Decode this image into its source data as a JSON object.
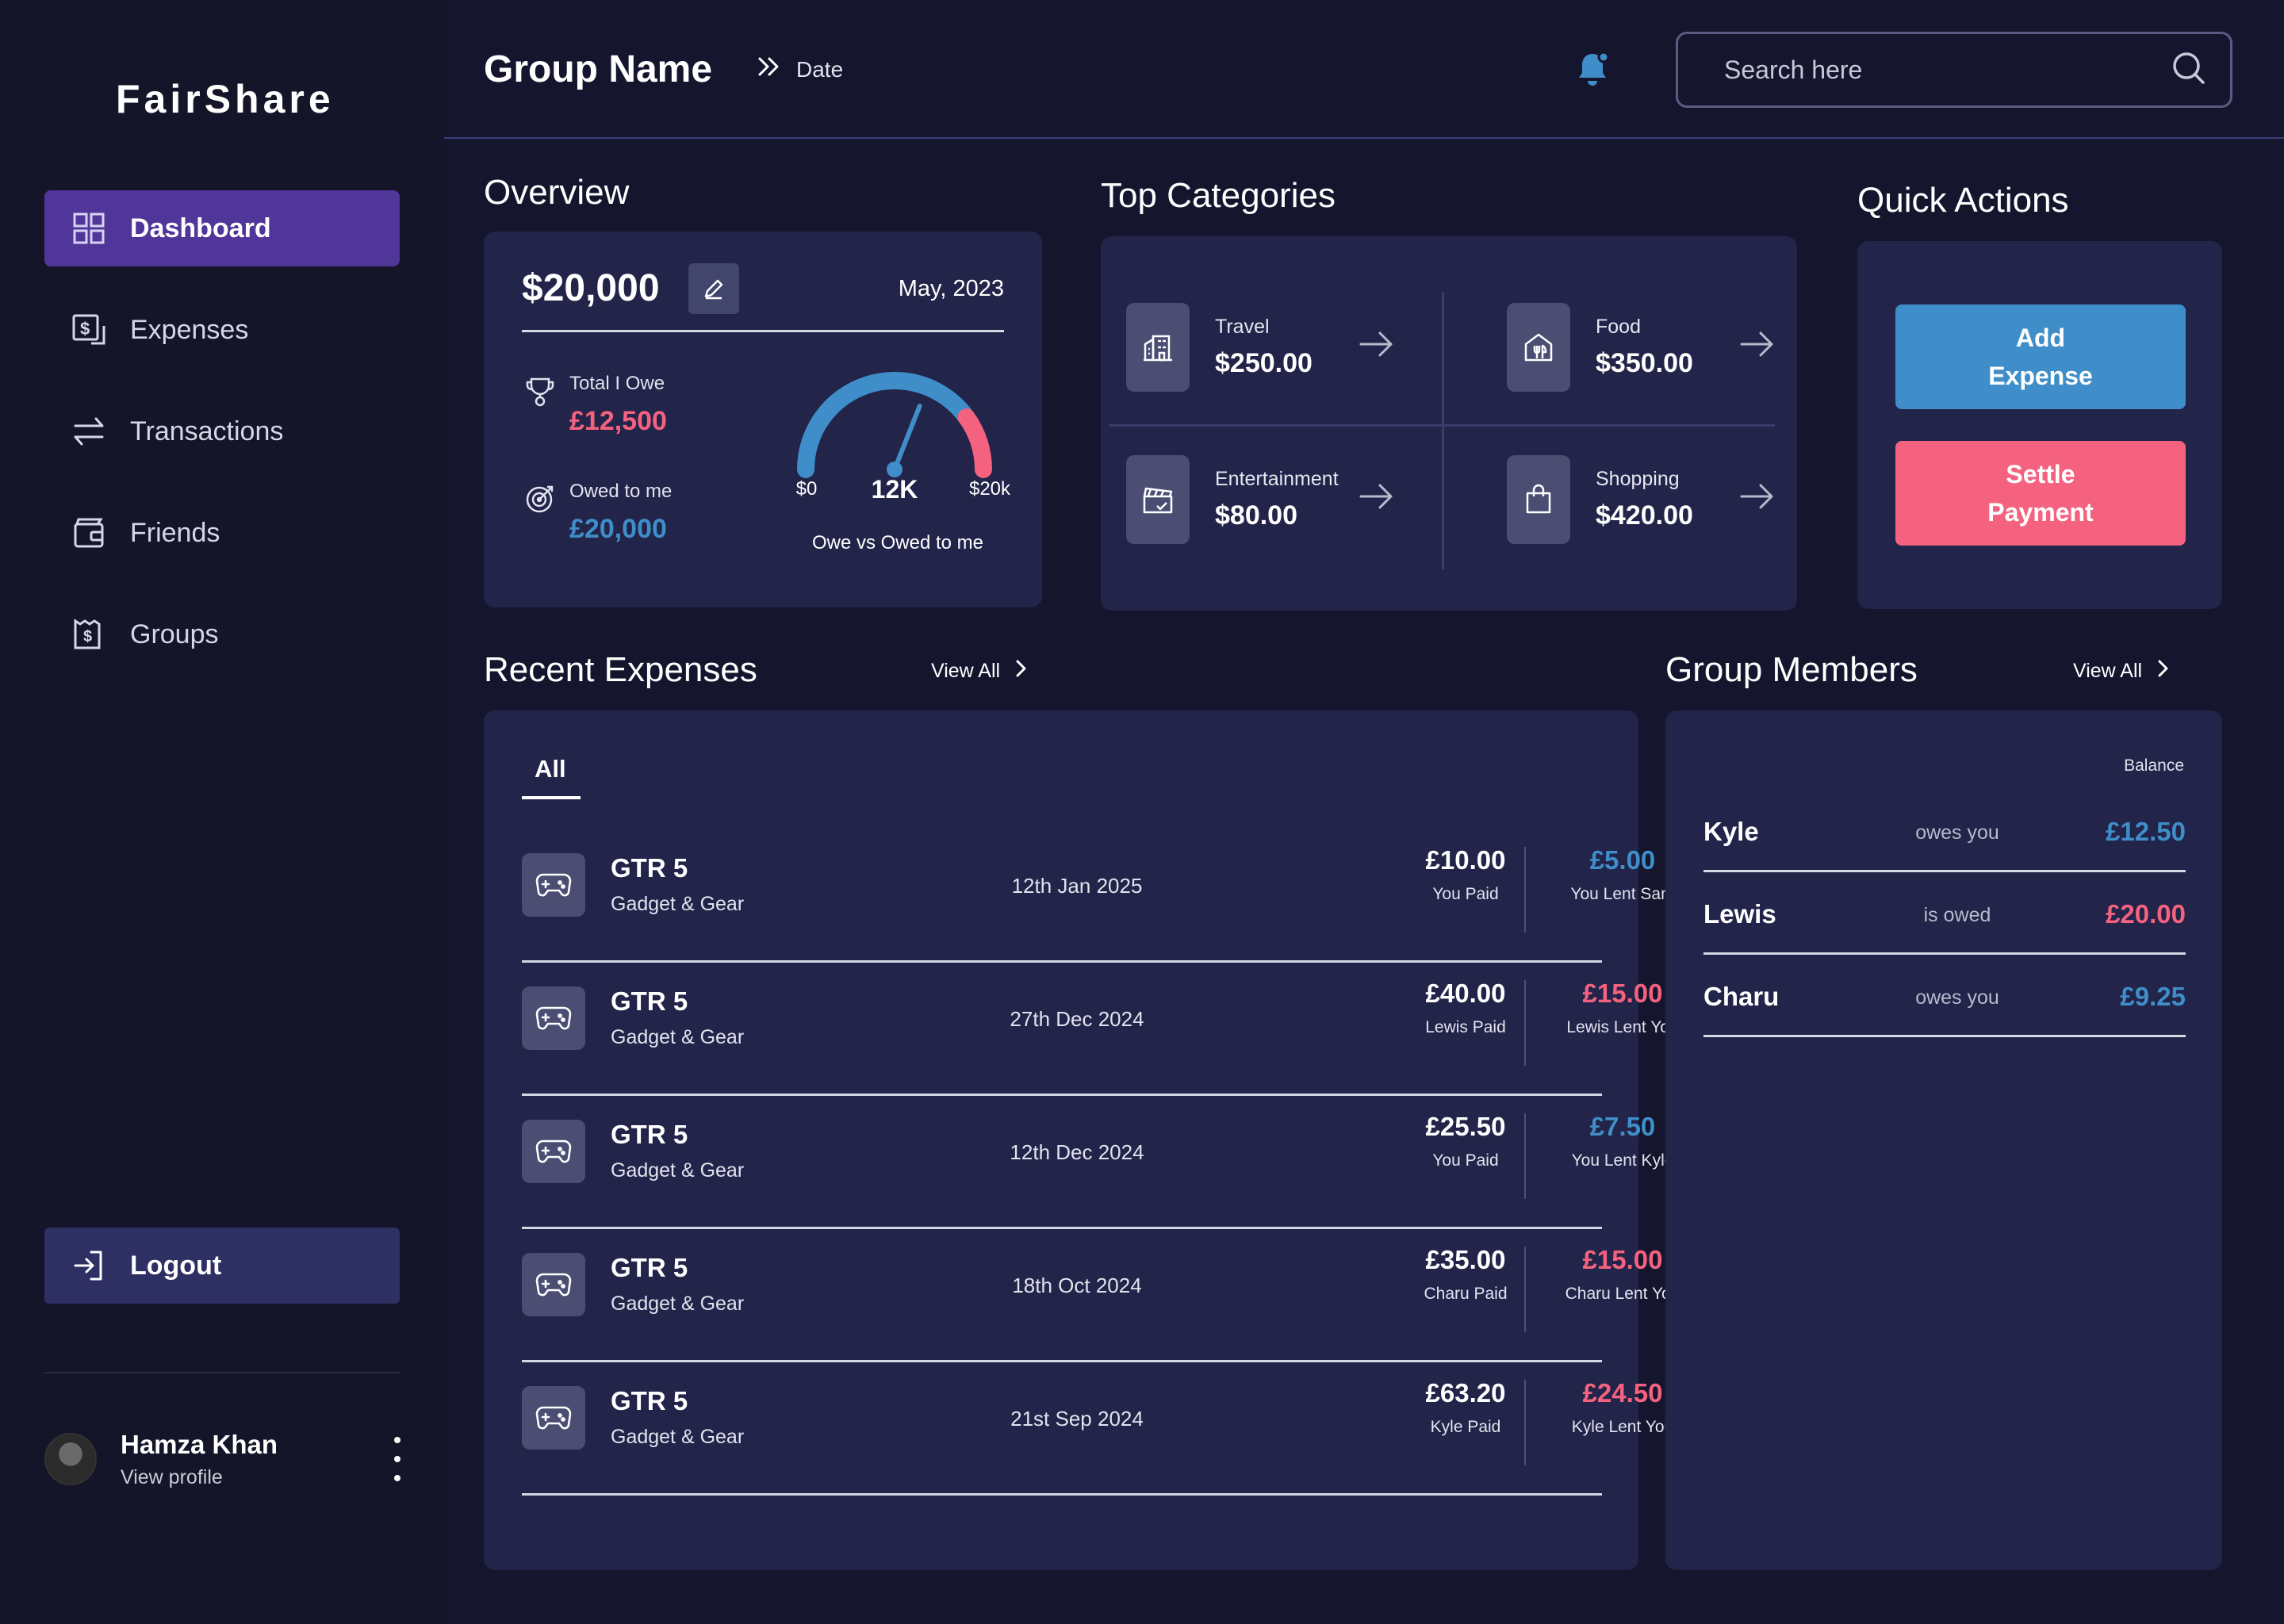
{
  "app": {
    "logo": "FairShare"
  },
  "colors": {
    "accent": "#51369a",
    "blue": "#3f8ec9",
    "pink": "#f4627f",
    "card": "#222449"
  },
  "sidebar": {
    "items": [
      {
        "label": "Dashboard",
        "icon": "dashboard-grid-icon",
        "active": true
      },
      {
        "label": "Expenses",
        "icon": "expense-receipt-icon"
      },
      {
        "label": "Transactions",
        "icon": "transfer-arrows-icon"
      },
      {
        "label": "Friends",
        "icon": "wallet-icon"
      },
      {
        "label": "Groups",
        "icon": "group-bill-icon"
      }
    ],
    "logout": "Logout",
    "profile": {
      "name": "Hamza Khan",
      "sub": "View profile"
    }
  },
  "header": {
    "group_name": "Group Name",
    "breadcrumb": "Date",
    "search_placeholder": "Search here"
  },
  "overview": {
    "title": "Overview",
    "amount": "$20,000",
    "date": "May, 2023",
    "owe_label": "Total I Owe",
    "owe_value": "£12,500",
    "owed_label": "Owed to me",
    "owed_value": "£20,000",
    "gauge": {
      "min_label": "$0",
      "value_label": "12K",
      "max_label": "$20k",
      "caption": "Owe vs Owed to me",
      "fraction": 0.62
    }
  },
  "categories": {
    "title": "Top Categories",
    "items": [
      {
        "label": "Travel",
        "value": "$250.00",
        "icon": "building-icon"
      },
      {
        "label": "Food",
        "value": "$350.00",
        "icon": "restaurant-icon"
      },
      {
        "label": "Entertainment",
        "value": "$80.00",
        "icon": "clapperboard-icon"
      },
      {
        "label": "Shopping",
        "value": "$420.00",
        "icon": "shopping-bag-icon"
      }
    ]
  },
  "quick_actions": {
    "title": "Quick Actions",
    "add": "Add\nExpense",
    "settle": "Settle\nPayment"
  },
  "recent": {
    "title": "Recent Expenses",
    "view_all": "View All",
    "tab": "All",
    "rows": [
      {
        "title": "GTR 5",
        "sub": "Gadget & Gear",
        "date": "12th Jan 2025",
        "paid": "£10.00",
        "paid_by": "You Paid",
        "lent": "£5.00",
        "lent_label": "You Lent Sam",
        "lent_color": "blue"
      },
      {
        "title": "GTR 5",
        "sub": "Gadget & Gear",
        "date": "27th Dec 2024",
        "paid": "£40.00",
        "paid_by": "Lewis Paid",
        "lent": "£15.00",
        "lent_label": "Lewis Lent You",
        "lent_color": "pink"
      },
      {
        "title": "GTR 5",
        "sub": "Gadget & Gear",
        "date": "12th Dec 2024",
        "paid": "£25.50",
        "paid_by": "You Paid",
        "lent": "£7.50",
        "lent_label": "You Lent Kyle",
        "lent_color": "blue"
      },
      {
        "title": "GTR 5",
        "sub": "Gadget & Gear",
        "date": "18th Oct 2024",
        "paid": "£35.00",
        "paid_by": "Charu Paid",
        "lent": "£15.00",
        "lent_label": "Charu Lent You",
        "lent_color": "pink"
      },
      {
        "title": "GTR 5",
        "sub": "Gadget & Gear",
        "date": "21st Sep 2024",
        "paid": "£63.20",
        "paid_by": "Kyle Paid",
        "lent": "£24.50",
        "lent_label": "Kyle Lent You",
        "lent_color": "pink"
      }
    ]
  },
  "members": {
    "title": "Group Members",
    "view_all": "View All",
    "balance_head": "Balance",
    "rows": [
      {
        "name": "Kyle",
        "relation": "owes you",
        "balance": "£12.50",
        "color": "blue"
      },
      {
        "name": "Lewis",
        "relation": "is owed",
        "balance": "£20.00",
        "color": "pink"
      },
      {
        "name": "Charu",
        "relation": "owes you",
        "balance": "£9.25",
        "color": "blue"
      }
    ]
  }
}
